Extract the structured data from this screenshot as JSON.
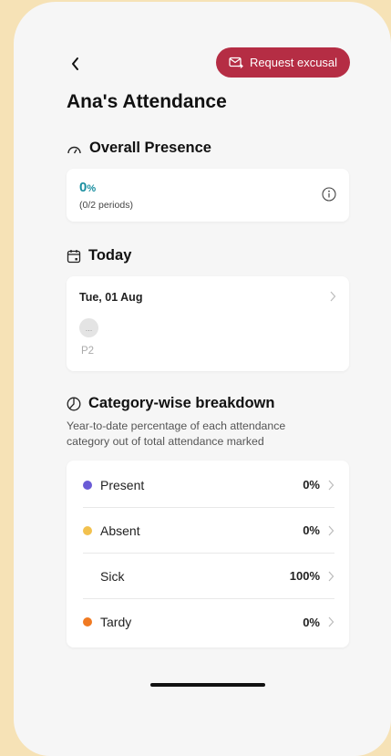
{
  "header": {
    "request_label": "Request excusal",
    "title": "Ana's Attendance"
  },
  "overall": {
    "heading": "Overall Presence",
    "percent_value": "0",
    "percent_sign": "%",
    "periods": "(0/2 periods)"
  },
  "today": {
    "heading": "Today",
    "date": "Tue, 01 Aug",
    "status_glyph": "...",
    "period": "P2"
  },
  "breakdown": {
    "heading": "Category-wise breakdown",
    "description": "Year-to-date percentage of each attendance category out of total attendance marked",
    "items": [
      {
        "label": "Present",
        "value": "0%",
        "color": "#6a5bd6"
      },
      {
        "label": "Absent",
        "value": "0%",
        "color": "#f2c14e"
      },
      {
        "label": "Sick",
        "value": "100%",
        "color": ""
      },
      {
        "label": "Tardy",
        "value": "0%",
        "color": "#f07a22"
      }
    ]
  },
  "icons": {
    "back": "chevron-left-icon",
    "request": "mail-arrow-icon",
    "overall": "gauge-icon",
    "info": "info-icon",
    "today": "calendar-icon",
    "breakdown": "pie-icon",
    "row_chevron": "chevron-right-icon"
  },
  "colors": {
    "accent_button": "#b52d44",
    "percent_teal": "#1a8fa0",
    "backdrop": "#f6e2b6"
  }
}
